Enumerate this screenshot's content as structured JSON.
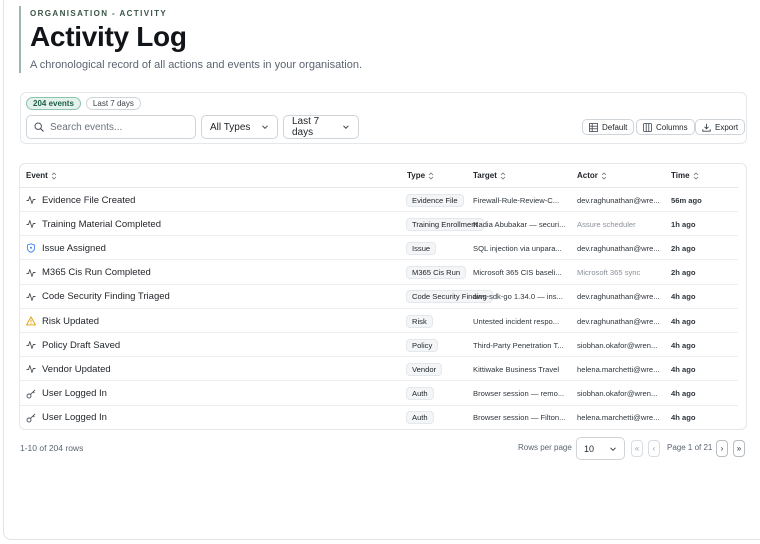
{
  "header": {
    "eyebrow": "ORGANISATION - ACTIVITY",
    "title": "Activity Log",
    "subtitle": "A chronological record of all actions and events in your organisation."
  },
  "filters": {
    "badge_count": "204 events",
    "badge_range": "Last 7 days",
    "search_placeholder": "Search events...",
    "type_select": "All Types",
    "range_select": "Last 7 days",
    "default_label": "Default",
    "columns_label": "Columns",
    "export_label": "Export"
  },
  "table": {
    "columns": {
      "event": "Event",
      "type": "Type",
      "target": "Target",
      "actor": "Actor",
      "time": "Time"
    },
    "rows": [
      {
        "icon": "activity-icon",
        "event": "Evidence File Created",
        "type": "Evidence File",
        "target": "Firewall-Rule-Review-C...",
        "actor": "dev.raghunathan@wre...",
        "actor_muted": false,
        "time": "56m ago"
      },
      {
        "icon": "activity-icon",
        "event": "Training Material Completed",
        "type": "Training Enrollment",
        "target": "Nadia Abubakar — securi...",
        "actor": "Assure scheduler",
        "actor_muted": true,
        "time": "1h ago"
      },
      {
        "icon": "shield-icon",
        "event": "Issue Assigned",
        "type": "Issue",
        "target": "SQL injection via unpara...",
        "actor": "dev.raghunathan@wre...",
        "actor_muted": false,
        "time": "2h ago"
      },
      {
        "icon": "activity-icon",
        "event": "M365 Cis Run Completed",
        "type": "M365 Cis Run",
        "target": "Microsoft 365 CIS baseli...",
        "actor": "Microsoft 365 sync",
        "actor_muted": true,
        "time": "2h ago"
      },
      {
        "icon": "activity-icon",
        "event": "Code Security Finding Triaged",
        "type": "Code Security Finding",
        "target": "aws-sdk-go 1.34.0 — ins...",
        "actor": "dev.raghunathan@wre...",
        "actor_muted": false,
        "time": "4h ago"
      },
      {
        "icon": "warning-icon",
        "event": "Risk Updated",
        "type": "Risk",
        "target": "Untested incident respo...",
        "actor": "dev.raghunathan@wre...",
        "actor_muted": false,
        "time": "4h ago"
      },
      {
        "icon": "activity-icon",
        "event": "Policy Draft Saved",
        "type": "Policy",
        "target": "Third-Party Penetration T...",
        "actor": "siobhan.okafor@wren...",
        "actor_muted": false,
        "time": "4h ago"
      },
      {
        "icon": "activity-icon",
        "event": "Vendor Updated",
        "type": "Vendor",
        "target": "Kittiwake Business Travel",
        "actor": "helena.marchetti@wre...",
        "actor_muted": false,
        "time": "4h ago"
      },
      {
        "icon": "key-icon",
        "event": "User Logged In",
        "type": "Auth",
        "target": "Browser session — remo...",
        "actor": "siobhan.okafor@wren...",
        "actor_muted": false,
        "time": "4h ago"
      },
      {
        "icon": "key-icon",
        "event": "User Logged In",
        "type": "Auth",
        "target": "Browser session — Filton...",
        "actor": "helena.marchetti@wre...",
        "actor_muted": false,
        "time": "4h ago"
      }
    ]
  },
  "pagination": {
    "summary": "1-10 of 204 rows",
    "rows_per_page_label": "Rows per page",
    "rows_per_page": "10",
    "page_info": "Page 1 of 21",
    "first": "«",
    "prev": "‹",
    "next": "›",
    "last": "»"
  },
  "colors": {
    "accent_border": "#9db8ad",
    "badge_green_bg": "#e3f2ec",
    "shield_blue": "#3b82f6",
    "warning_amber": "#e0a100"
  }
}
